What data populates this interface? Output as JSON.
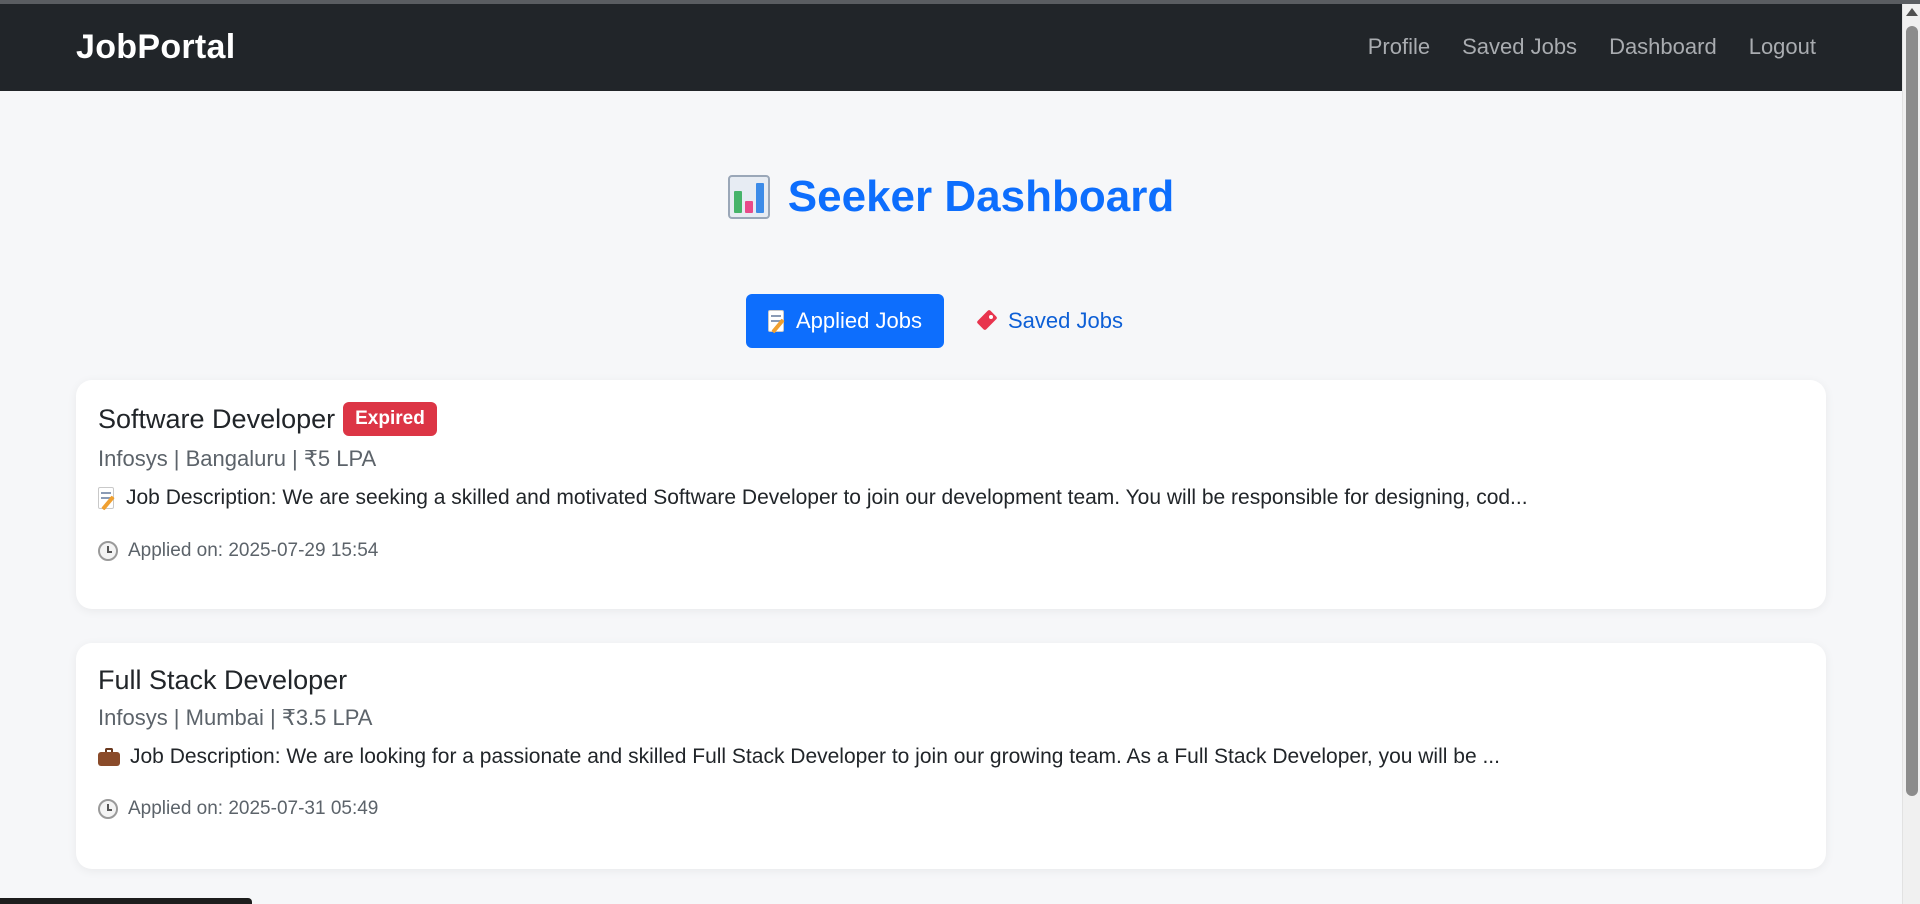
{
  "navbar": {
    "brand": "JobPortal",
    "links": [
      "Profile",
      "Saved Jobs",
      "Dashboard",
      "Logout"
    ]
  },
  "page": {
    "title": "Seeker Dashboard",
    "title_icon": "bar-chart-icon"
  },
  "tabs": [
    {
      "label": "Applied Jobs",
      "icon": "memo-icon",
      "active": true
    },
    {
      "label": "Saved Jobs",
      "icon": "tag-icon",
      "active": false
    }
  ],
  "jobs": [
    {
      "title": "Software Developer",
      "badge": "Expired",
      "meta": "Infosys | Bangaluru | ₹5 LPA",
      "description": "Job Description: We are seeking a skilled and motivated Software Developer to join our development team. You will be responsible for designing, cod...",
      "description_icon": "memo-icon",
      "applied": "Applied on: 2025-07-29 15:54"
    },
    {
      "title": "Full Stack Developer",
      "badge": "",
      "meta": "Infosys | Mumbai | ₹3.5 LPA",
      "description": "Job Description: We are looking for a passionate and skilled Full Stack Developer to join our growing team. As a Full Stack Developer, you will be ...",
      "description_icon": "briefcase-icon",
      "applied": "Applied on: 2025-07-31 05:49"
    }
  ],
  "colors": {
    "navbar_bg": "#212529",
    "primary": "#0d6efd",
    "badge_danger": "#dc3545"
  }
}
